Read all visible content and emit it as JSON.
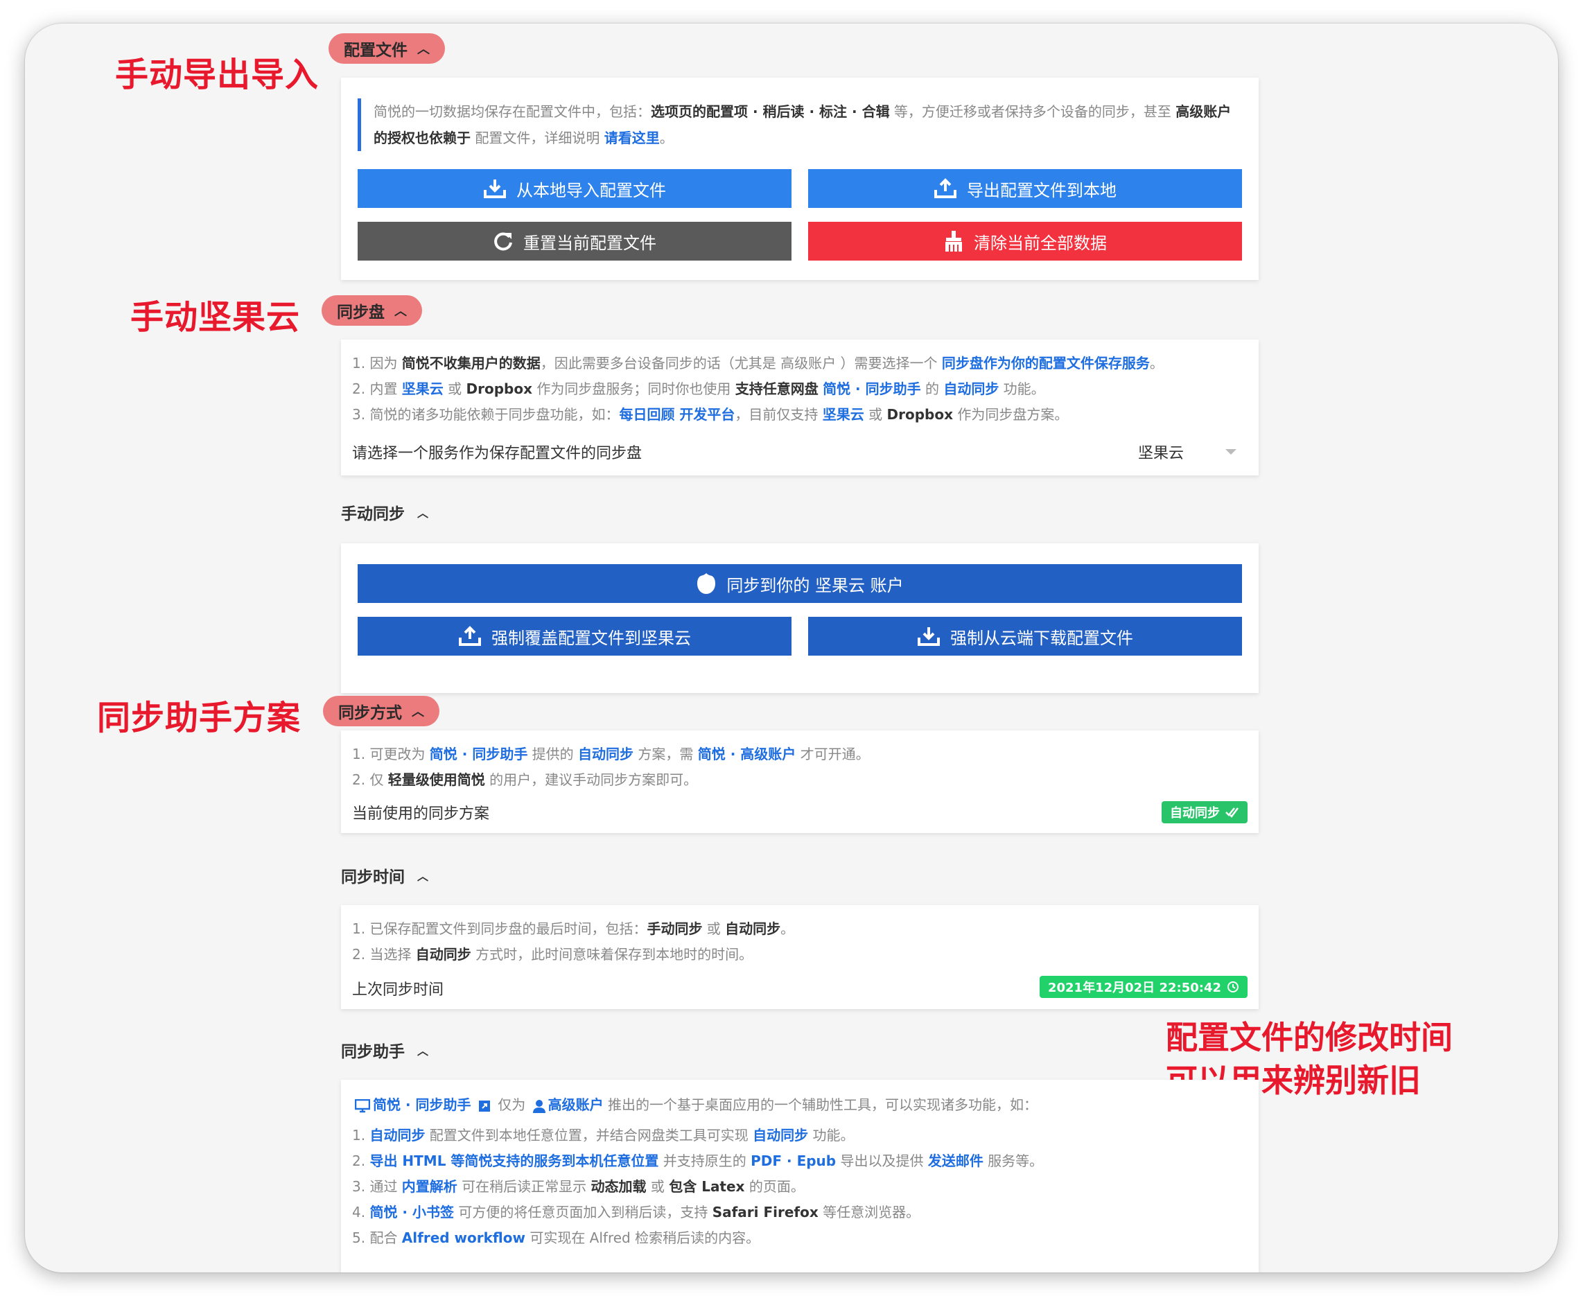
{
  "annotations": {
    "export_import": "手动导出导入",
    "nutstore": "手动坚果云",
    "assistant_plan": "同步助手方案",
    "modify_time_line1": "配置文件的修改时间",
    "modify_time_line2": "可以用来辨别新旧"
  },
  "config_section": {
    "pill": "配置文件",
    "desc_a": "简悦的一切数据均保存在配置文件中，包括：",
    "desc_b": "选项页的配置项 · 稍后读 · 标注 · 合辑",
    "desc_c": " 等，方便迁移或者保持多个设备的同步，甚至 ",
    "desc_d": "高级账户的授权也依赖于",
    "desc_e": " 配置文件，详细说明 ",
    "desc_link": "请看这里",
    "desc_end": "。",
    "import_btn": "从本地导入配置文件",
    "export_btn": "导出配置文件到本地",
    "reset_btn": "重置当前配置文件",
    "clear_btn": "清除当前全部数据"
  },
  "sync_disk": {
    "pill": "同步盘",
    "l1_a": "1. 因为 ",
    "l1_b": "简悦不收集用户的数据",
    "l1_c": "，因此需要多台设备同步的话（尤其是 高级账户 ）需要选择一个 ",
    "l1_link": "同步盘作为你的配置文件保存服务",
    "l1_end": "。",
    "l2_a": "2. 内置 ",
    "l2_link1": "坚果云",
    "l2_b": " 或 ",
    "l2_c": "Dropbox",
    "l2_d": " 作为同步盘服务；同时你也使用 ",
    "l2_e": "支持任意网盘",
    "l2_link2": "简悦 · 同步助手",
    "l2_f": " 的 ",
    "l2_link3": "自动同步",
    "l2_g": " 功能。",
    "l3_a": "3. 简悦的诸多功能依赖于同步盘功能，如：",
    "l3_link1": "每日回顾 开发平台",
    "l3_b": "，目前仅支持 ",
    "l3_link2": "坚果云",
    "l3_c": " 或 ",
    "l3_d": "Dropbox",
    "l3_e": " 作为同步盘方案。",
    "select_label": "请选择一个服务作为保存配置文件的同步盘",
    "select_value": "坚果云"
  },
  "manual_sync": {
    "title": "手动同步",
    "sync_btn": "同步到你的 坚果云 账户",
    "overwrite_btn": "强制覆盖配置文件到坚果云",
    "download_btn": "强制从云端下载配置文件"
  },
  "sync_method": {
    "pill": "同步方式",
    "l1_a": "1. 可更改为 ",
    "l1_link1": "简悦 · 同步助手",
    "l1_b": " 提供的 ",
    "l1_link2": "自动同步",
    "l1_c": " 方案，需 ",
    "l1_link3": "简悦 · 高级账户",
    "l1_d": " 才可开通。",
    "l2_a": "2. 仅 ",
    "l2_b": "轻量级使用简悦",
    "l2_c": " 的用户，建议手动同步方案即可。",
    "current_label": "当前使用的同步方案",
    "badge": "自动同步"
  },
  "sync_time": {
    "title": "同步时间",
    "l1_a": "1. 已保存配置文件到同步盘的最后时间，包括：",
    "l1_b": "手动同步",
    "l1_c": " 或 ",
    "l1_d": "自动同步",
    "l1_e": "。",
    "l2_a": "2. 当选择 ",
    "l2_b": "自动同步",
    "l2_c": " 方式时，此时间意味着保存到本地时的时间。",
    "last_label": "上次同步时间",
    "badge": "2021年12月02日 22:50:42"
  },
  "sync_assistant": {
    "title": "同步助手",
    "intro_link1": "简悦 · 同步助手",
    "intro_a": " 仅为 ",
    "intro_link2": "高级账户",
    "intro_b": " 推出的一个基于桌面应用的一个辅助性工具，可以实现诸多功能，如：",
    "i1_a": "1. ",
    "i1_link1": "自动同步",
    "i1_b": " 配置文件到本地任意位置，并结合网盘类工具可实现 ",
    "i1_link2": "自动同步",
    "i1_c": " 功能。",
    "i2_a": "2. ",
    "i2_link1": "导出 HTML 等简悦支持的服务到本机任意位置",
    "i2_b": " 并支持原生的 ",
    "i2_link2": "PDF · Epub",
    "i2_c": " 导出以及提供 ",
    "i2_link3": "发送邮件",
    "i2_d": " 服务等。",
    "i3_a": "3. 通过 ",
    "i3_link1": "内置解析",
    "i3_b": " 可在稍后读正常显示 ",
    "i3_c": "动态加载",
    "i3_d": " 或 ",
    "i3_e": "包含 Latex",
    "i3_f": " 的页面。",
    "i4_a": "4. ",
    "i4_link1": "简悦 · 小书签",
    "i4_b": " 可方便的将任意页面加入到稍后读，支持 ",
    "i4_c": "Safari Firefox",
    "i4_d": " 等任意浏览器。",
    "i5_a": "5. 配合 ",
    "i5_link1": "Alfred workflow",
    "i5_b": " 可实现在 Alfred 检索稍后读的内容。"
  },
  "colors": {
    "annotation_red": "#e8192c",
    "pill_bg": "#ec7b7d",
    "primary_blue": "#2d82eb",
    "dark_blue": "#2360c4",
    "danger_red": "#f2323f",
    "neutral_gray": "#5a5a5a",
    "badge_green": "#29c46a"
  },
  "icons": {
    "import": "download-tray-icon",
    "export": "upload-tray-icon",
    "reset": "refresh-icon",
    "clear": "broom-icon",
    "nutstore": "nutstore-logo-icon",
    "check": "double-check-icon",
    "history": "history-icon",
    "desktop": "desktop-icon",
    "external": "external-link-icon",
    "user": "user-icon"
  }
}
